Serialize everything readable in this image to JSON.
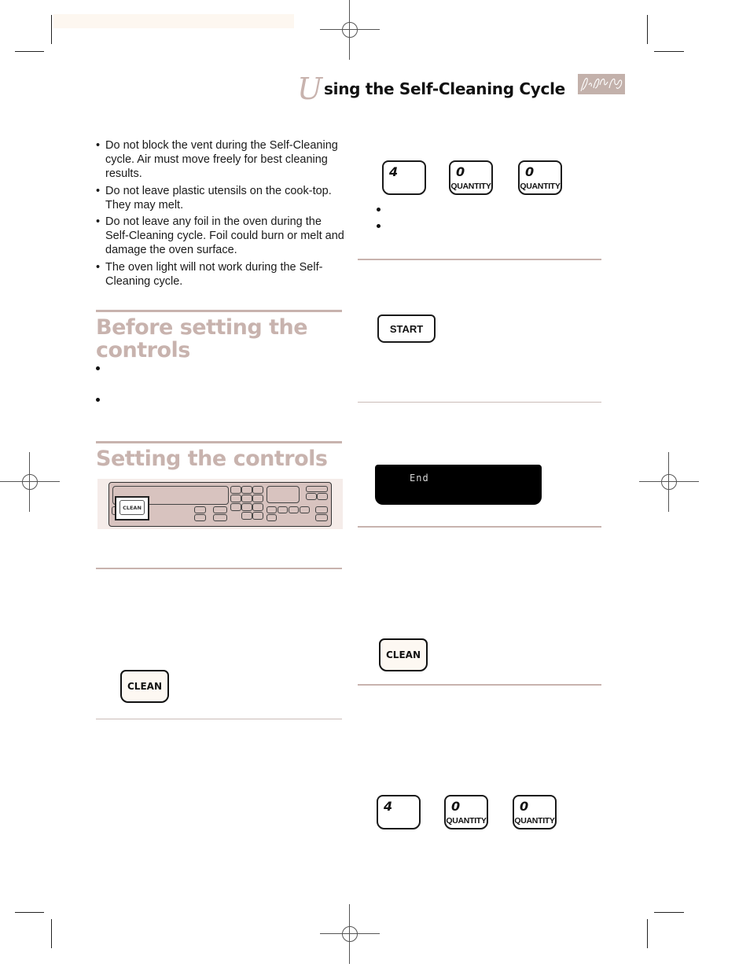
{
  "header": {
    "initial": "U",
    "title": "sing the Self-Cleaning Cycle",
    "signature_icon": "signature-logo"
  },
  "left": {
    "cautions": [
      "Do not block the vent during the Self-Cleaning cycle. Air must move freely for best cleaning results.",
      "Do not leave plastic utensils on the cook-top. They may melt.",
      "Do not leave any foil in the oven during the Self-Cleaning cycle. Foil could burn or melt and damage the oven surface.",
      "The oven light will not work during the Self-Cleaning cycle."
    ],
    "section_before": {
      "heading_line1": "Before setting the",
      "heading_line2": "controls"
    },
    "section_setting": {
      "heading": "Setting the controls",
      "panel_clean_label": "CLEAN"
    },
    "clean_button": "CLEAN"
  },
  "right": {
    "keypad_top": [
      {
        "digit": "4",
        "sub": ""
      },
      {
        "digit": "0",
        "sub": "QUANTITY"
      },
      {
        "digit": "0",
        "sub": "QUANTITY"
      }
    ],
    "start_button": "START",
    "display_text": "End",
    "clean_button": "CLEAN",
    "keypad_bottom": [
      {
        "digit": "4",
        "sub": ""
      },
      {
        "digit": "0",
        "sub": "QUANTITY"
      },
      {
        "digit": "0",
        "sub": "QUANTITY"
      }
    ]
  },
  "colors": {
    "accent": "#c8b3ae",
    "display_bg": "#000000",
    "key_face": "#fdf8f2"
  }
}
